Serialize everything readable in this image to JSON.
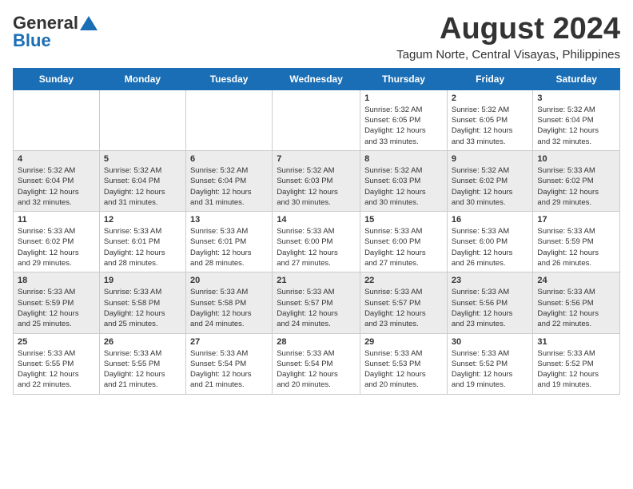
{
  "header": {
    "logo_general": "General",
    "logo_blue": "Blue",
    "month_year": "August 2024",
    "location": "Tagum Norte, Central Visayas, Philippines"
  },
  "days_of_week": [
    "Sunday",
    "Monday",
    "Tuesday",
    "Wednesday",
    "Thursday",
    "Friday",
    "Saturday"
  ],
  "weeks": [
    [
      {
        "day": "",
        "info": ""
      },
      {
        "day": "",
        "info": ""
      },
      {
        "day": "",
        "info": ""
      },
      {
        "day": "",
        "info": ""
      },
      {
        "day": "1",
        "info": "Sunrise: 5:32 AM\nSunset: 6:05 PM\nDaylight: 12 hours\nand 33 minutes."
      },
      {
        "day": "2",
        "info": "Sunrise: 5:32 AM\nSunset: 6:05 PM\nDaylight: 12 hours\nand 33 minutes."
      },
      {
        "day": "3",
        "info": "Sunrise: 5:32 AM\nSunset: 6:04 PM\nDaylight: 12 hours\nand 32 minutes."
      }
    ],
    [
      {
        "day": "4",
        "info": "Sunrise: 5:32 AM\nSunset: 6:04 PM\nDaylight: 12 hours\nand 32 minutes."
      },
      {
        "day": "5",
        "info": "Sunrise: 5:32 AM\nSunset: 6:04 PM\nDaylight: 12 hours\nand 31 minutes."
      },
      {
        "day": "6",
        "info": "Sunrise: 5:32 AM\nSunset: 6:04 PM\nDaylight: 12 hours\nand 31 minutes."
      },
      {
        "day": "7",
        "info": "Sunrise: 5:32 AM\nSunset: 6:03 PM\nDaylight: 12 hours\nand 30 minutes."
      },
      {
        "day": "8",
        "info": "Sunrise: 5:32 AM\nSunset: 6:03 PM\nDaylight: 12 hours\nand 30 minutes."
      },
      {
        "day": "9",
        "info": "Sunrise: 5:32 AM\nSunset: 6:02 PM\nDaylight: 12 hours\nand 30 minutes."
      },
      {
        "day": "10",
        "info": "Sunrise: 5:33 AM\nSunset: 6:02 PM\nDaylight: 12 hours\nand 29 minutes."
      }
    ],
    [
      {
        "day": "11",
        "info": "Sunrise: 5:33 AM\nSunset: 6:02 PM\nDaylight: 12 hours\nand 29 minutes."
      },
      {
        "day": "12",
        "info": "Sunrise: 5:33 AM\nSunset: 6:01 PM\nDaylight: 12 hours\nand 28 minutes."
      },
      {
        "day": "13",
        "info": "Sunrise: 5:33 AM\nSunset: 6:01 PM\nDaylight: 12 hours\nand 28 minutes."
      },
      {
        "day": "14",
        "info": "Sunrise: 5:33 AM\nSunset: 6:00 PM\nDaylight: 12 hours\nand 27 minutes."
      },
      {
        "day": "15",
        "info": "Sunrise: 5:33 AM\nSunset: 6:00 PM\nDaylight: 12 hours\nand 27 minutes."
      },
      {
        "day": "16",
        "info": "Sunrise: 5:33 AM\nSunset: 6:00 PM\nDaylight: 12 hours\nand 26 minutes."
      },
      {
        "day": "17",
        "info": "Sunrise: 5:33 AM\nSunset: 5:59 PM\nDaylight: 12 hours\nand 26 minutes."
      }
    ],
    [
      {
        "day": "18",
        "info": "Sunrise: 5:33 AM\nSunset: 5:59 PM\nDaylight: 12 hours\nand 25 minutes."
      },
      {
        "day": "19",
        "info": "Sunrise: 5:33 AM\nSunset: 5:58 PM\nDaylight: 12 hours\nand 25 minutes."
      },
      {
        "day": "20",
        "info": "Sunrise: 5:33 AM\nSunset: 5:58 PM\nDaylight: 12 hours\nand 24 minutes."
      },
      {
        "day": "21",
        "info": "Sunrise: 5:33 AM\nSunset: 5:57 PM\nDaylight: 12 hours\nand 24 minutes."
      },
      {
        "day": "22",
        "info": "Sunrise: 5:33 AM\nSunset: 5:57 PM\nDaylight: 12 hours\nand 23 minutes."
      },
      {
        "day": "23",
        "info": "Sunrise: 5:33 AM\nSunset: 5:56 PM\nDaylight: 12 hours\nand 23 minutes."
      },
      {
        "day": "24",
        "info": "Sunrise: 5:33 AM\nSunset: 5:56 PM\nDaylight: 12 hours\nand 22 minutes."
      }
    ],
    [
      {
        "day": "25",
        "info": "Sunrise: 5:33 AM\nSunset: 5:55 PM\nDaylight: 12 hours\nand 22 minutes."
      },
      {
        "day": "26",
        "info": "Sunrise: 5:33 AM\nSunset: 5:55 PM\nDaylight: 12 hours\nand 21 minutes."
      },
      {
        "day": "27",
        "info": "Sunrise: 5:33 AM\nSunset: 5:54 PM\nDaylight: 12 hours\nand 21 minutes."
      },
      {
        "day": "28",
        "info": "Sunrise: 5:33 AM\nSunset: 5:54 PM\nDaylight: 12 hours\nand 20 minutes."
      },
      {
        "day": "29",
        "info": "Sunrise: 5:33 AM\nSunset: 5:53 PM\nDaylight: 12 hours\nand 20 minutes."
      },
      {
        "day": "30",
        "info": "Sunrise: 5:33 AM\nSunset: 5:52 PM\nDaylight: 12 hours\nand 19 minutes."
      },
      {
        "day": "31",
        "info": "Sunrise: 5:33 AM\nSunset: 5:52 PM\nDaylight: 12 hours\nand 19 minutes."
      }
    ]
  ]
}
